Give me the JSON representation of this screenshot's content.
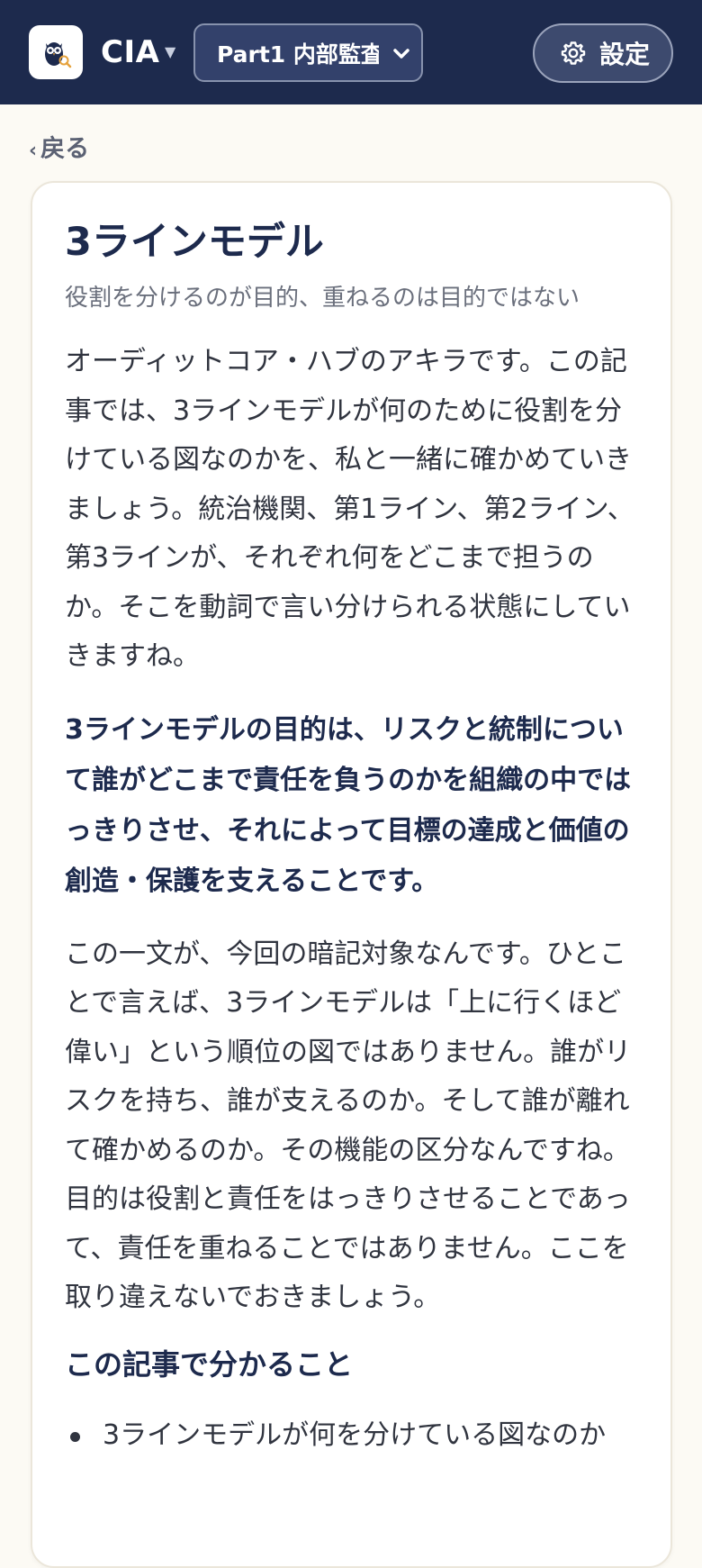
{
  "header": {
    "app_name": "CIA",
    "part_select": {
      "value": "Part1 内部監査"
    },
    "settings_label": "設定",
    "colors": {
      "bar": "#1d2a4d",
      "button": "#3d4a6e"
    }
  },
  "nav": {
    "back_label": "戻る"
  },
  "article": {
    "title": "3ラインモデル",
    "subtitle": "役割を分けるのが目的、重ねるのは目的ではない",
    "intro": "オーディットコア・ハブのアキラです。この記事では、3ラインモデルが何のために役割を分けている図なのかを、私と一緒に確かめていきましょう。統治機関、第1ライン、第2ライン、第3ラインが、それぞれ何をどこまで担うのか。そこを動詞で言い分けられる状態にしていきますね。",
    "key_sentence": "3ラインモデルの目的は、リスクと統制について誰がどこまで責任を負うのかを組織の中ではっきりさせ、それによって目標の達成と価値の創造・保護を支えることです。",
    "explanation": "この一文が、今回の暗記対象なんです。ひとことで言えば、3ラインモデルは「上に行くほど偉い」という順位の図ではありません。誰がリスクを持ち、誰が支えるのか。そして誰が離れて確かめるのか。その機能の区分なんですね。目的は役割と責任をはっきりさせることであって、責任を重ねることではありません。ここを取り違えないでおきましょう。",
    "section_heading": "この記事で分かること",
    "learn_points": [
      "3ラインモデルが何を分けている図なのか"
    ]
  },
  "icons": {
    "logo": "owl-logo-icon",
    "caret": "caret-down-icon",
    "select_chevron": "chevron-down-icon",
    "settings": "gear-icon",
    "back": "chevron-left-icon"
  }
}
